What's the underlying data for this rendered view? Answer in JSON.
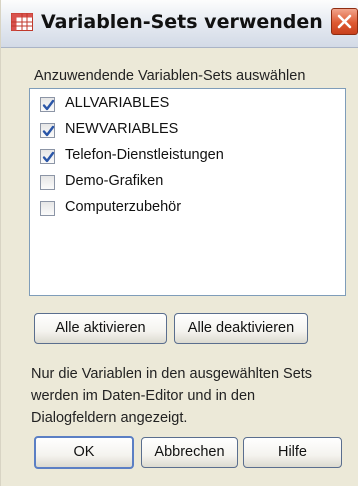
{
  "dialog": {
    "title": "Variablen-Sets verwenden",
    "icon": "spreadsheet-grid-icon",
    "close_icon": "close-icon"
  },
  "sets_group": {
    "label": "Anzuwendende Variablen-Sets auswählen",
    "items": [
      {
        "label": "ALLVARIABLES",
        "checked": true
      },
      {
        "label": "NEWVARIABLES",
        "checked": true
      },
      {
        "label": "Telefon-Dienstleistungen",
        "checked": true
      },
      {
        "label": "Demo-Grafiken",
        "checked": false
      },
      {
        "label": "Computerzubehör",
        "checked": false
      }
    ]
  },
  "actions": {
    "select_all": "Alle aktivieren",
    "deselect_all": "Alle deaktivieren"
  },
  "info_text": "Nur die Variablen in den ausgewählten Sets werden im Daten-Editor und in den Dialogfeldern angezeigt.",
  "footer": {
    "ok": "OK",
    "cancel": "Abbrechen",
    "help": "Hilfe"
  },
  "colors": {
    "dialog_bg": "#ece9d8",
    "close_button": "#de5a32",
    "default_button_border": "#5b7fc4",
    "checkmark": "#2a56a8"
  }
}
